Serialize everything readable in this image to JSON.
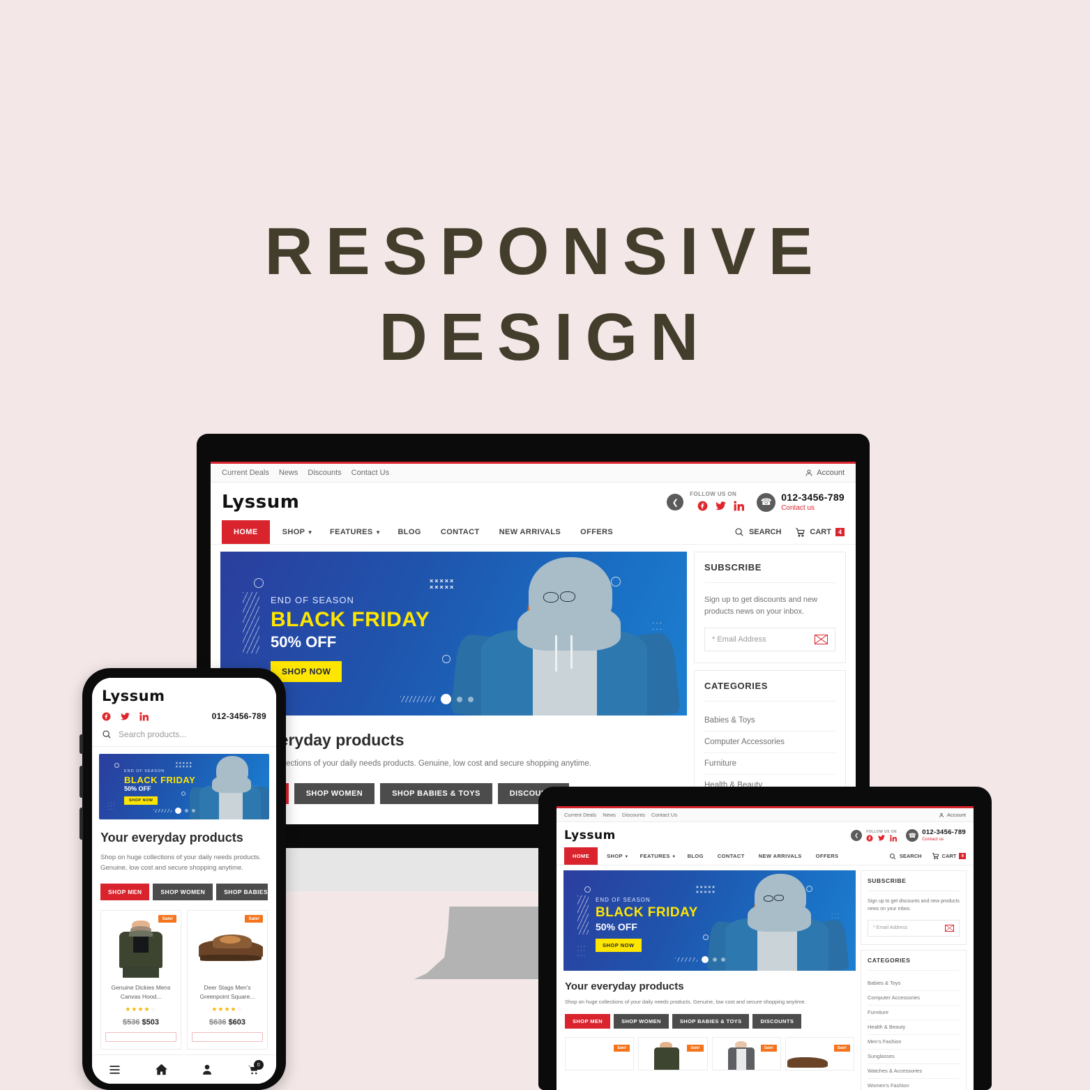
{
  "hero": {
    "line1": "RESPONSIVE",
    "line2": "DESIGN",
    "color": "#433d2b",
    "background": "#f3e7e7"
  },
  "site": {
    "brand": "Lyssum",
    "accent_red": "#d9232d",
    "topbar": {
      "links": [
        "Current Deals",
        "News",
        "Discounts",
        "Contact Us"
      ],
      "account_label": "Account"
    },
    "header": {
      "follow_label": "FOLLOW US ON",
      "social_icons": [
        "share-icon",
        "facebook-icon",
        "twitter-icon",
        "linkedin-icon"
      ],
      "phone": "012-3456-789",
      "contact_link": "Contact us"
    },
    "nav": {
      "items": [
        {
          "label": "HOME",
          "active": true,
          "caret": false
        },
        {
          "label": "SHOP",
          "active": false,
          "caret": true
        },
        {
          "label": "FEATURES",
          "active": false,
          "caret": true
        },
        {
          "label": "BLOG",
          "active": false,
          "caret": false
        },
        {
          "label": "CONTACT",
          "active": false,
          "caret": false
        },
        {
          "label": "NEW ARRIVALS",
          "active": false,
          "caret": false
        },
        {
          "label": "OFFERS",
          "active": false,
          "caret": false
        }
      ],
      "search_label": "SEARCH",
      "cart_label": "CART",
      "cart_count": "4"
    },
    "banner": {
      "eyebrow": "END OF SEASON",
      "headline": "BLACK FRIDAY",
      "subline": "50% OFF",
      "cta": "SHOP NOW",
      "slide_count": 3,
      "active_slide": 1,
      "bg_colors": [
        "#2b3e9e",
        "#1d7fd0"
      ],
      "headline_color": "#ffe600"
    },
    "section": {
      "title": "Your everyday products",
      "subtitle": "Shop on huge collections of your daily needs products. Genuine, low cost and secure shopping anytime.",
      "buttons": [
        {
          "label": "SHOP MEN",
          "primary": true
        },
        {
          "label": "SHOP WOMEN",
          "primary": false
        },
        {
          "label": "SHOP BABIES & TOYS",
          "primary": false
        },
        {
          "label": "DISCOUNTS",
          "primary": false
        }
      ]
    },
    "subscribe": {
      "title": "SUBSCRIBE",
      "text": "Sign up to get discounts and new products news on your inbox.",
      "email_placeholder": "* Email Address",
      "submit_icon": "envelope-icon"
    },
    "categories": {
      "title": "CATEGORIES",
      "items": [
        "Babies & Toys",
        "Computer Accessories",
        "Furniture",
        "Health & Beauty",
        "Men's Fashion",
        "Sunglasses",
        "Watches & Accessories",
        "Women's Fashion"
      ]
    },
    "products": [
      {
        "name": "Genuine Dickies Mens Canvas Hood...",
        "badge": "Sale!",
        "stars": "★★★★",
        "half_star": "☆",
        "old_price": "$536",
        "new_price": "$503",
        "image": "green-hooded-jacket"
      },
      {
        "name": "Deer Stags Men's Greenpoint Square...",
        "badge": "Sale!",
        "stars": "★★★★",
        "half_star": "☆",
        "old_price": "$636",
        "new_price": "$603",
        "image": "brown-loafer-shoe"
      }
    ],
    "mobile": {
      "search_placeholder": "Search products...",
      "phone": "012-3456-789",
      "tabbar": [
        {
          "icon": "menu-icon",
          "name": "menu"
        },
        {
          "icon": "home-icon",
          "name": "home"
        },
        {
          "icon": "person-icon",
          "name": "account"
        },
        {
          "icon": "cart-icon",
          "name": "cart",
          "badge": "0"
        }
      ]
    },
    "tablet_products_badges": [
      "Sale!",
      "Sale!",
      "Sale!",
      "Sale!"
    ]
  }
}
